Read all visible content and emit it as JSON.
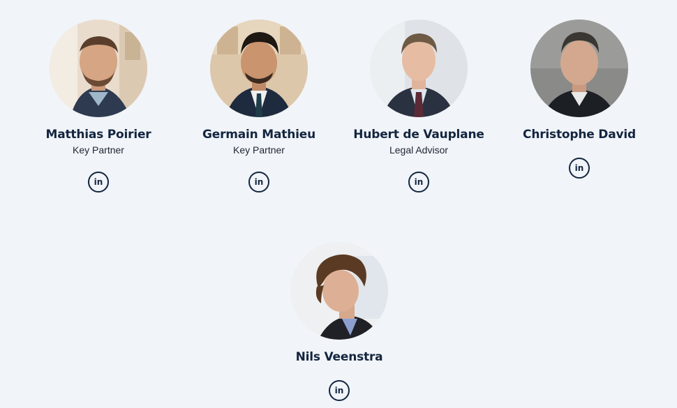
{
  "team": [
    {
      "name": "Matthias Poirier",
      "role": "Key Partner",
      "linkedin_label": "in"
    },
    {
      "name": "Germain Mathieu",
      "role": "Key Partner",
      "linkedin_label": "in"
    },
    {
      "name": "Hubert de Vauplane",
      "role": "Legal Advisor",
      "linkedin_label": "in"
    },
    {
      "name": "Christophe David",
      "linkedin_label": "in"
    },
    {
      "name": "Nils Veenstra",
      "linkedin_label": "in"
    }
  ],
  "colors": {
    "background": "#f1f4f8",
    "text": "#13253f"
  },
  "icons": {
    "social": "linkedin-icon"
  }
}
